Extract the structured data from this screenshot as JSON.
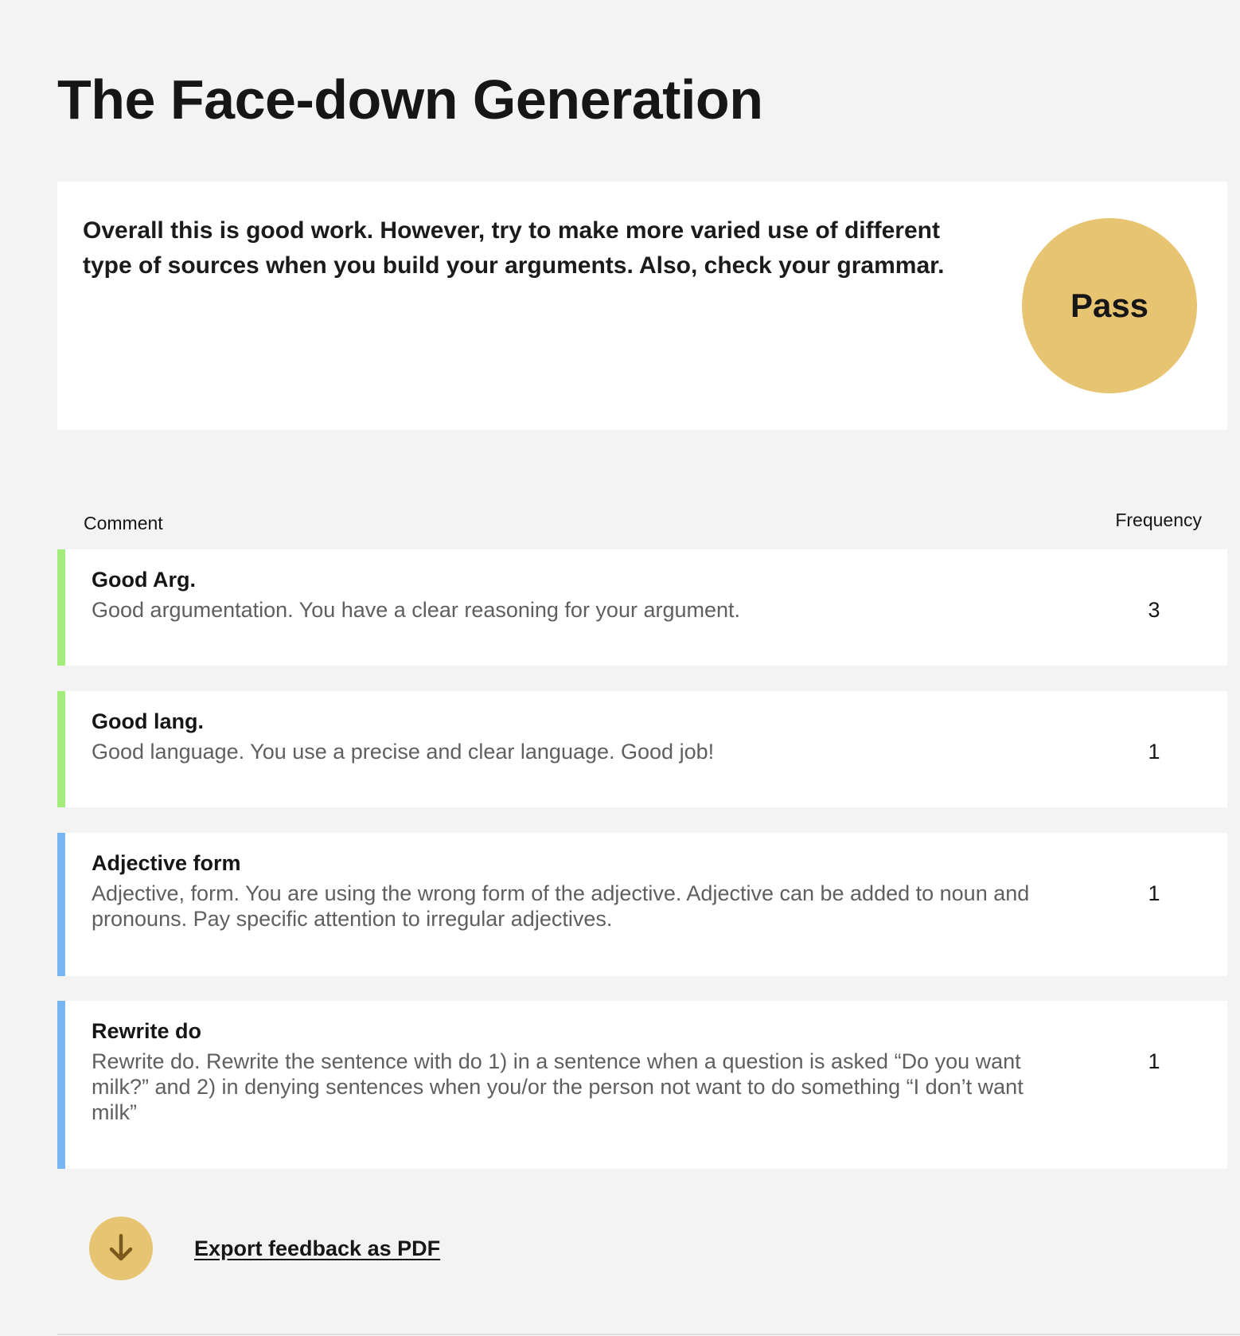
{
  "page": {
    "title": "The Face-down Generation"
  },
  "summary": {
    "text": "Overall this is good work. However, try to make more varied use of different type of sources when you build your arguments. Also, check your grammar.",
    "grade": "Pass",
    "grade_color": "#e6c472"
  },
  "table": {
    "headers": {
      "comment": "Comment",
      "frequency": "Frequency"
    },
    "rows": [
      {
        "title": "Good Arg.",
        "text": "Good argumentation. You have a clear reasoning for your argument.",
        "frequency": "3",
        "accent": "#a4ec7c"
      },
      {
        "title": "Good lang.",
        "text": "Good language. You use a precise and clear language. Good job!",
        "frequency": "1",
        "accent": "#a4ec7c"
      },
      {
        "title": "Adjective form",
        "text": "Adjective, form. You are using the wrong form of the adjective. Adjective can be added to noun and pronouns. Pay specific attention to irregular adjectives.",
        "frequency": "1",
        "accent": "#77b6f3"
      },
      {
        "title": "Rewrite do",
        "text": "Rewrite do. Rewrite the sentence with do 1) in a sentence when a question is asked “Do you want milk?” and 2) in denying sentences when you/or the person not want to do something “I don’t want milk”",
        "frequency": "1",
        "accent": "#77b6f3"
      }
    ]
  },
  "export": {
    "label": "Export feedback as PDF",
    "icon": "arrow-down-icon"
  }
}
